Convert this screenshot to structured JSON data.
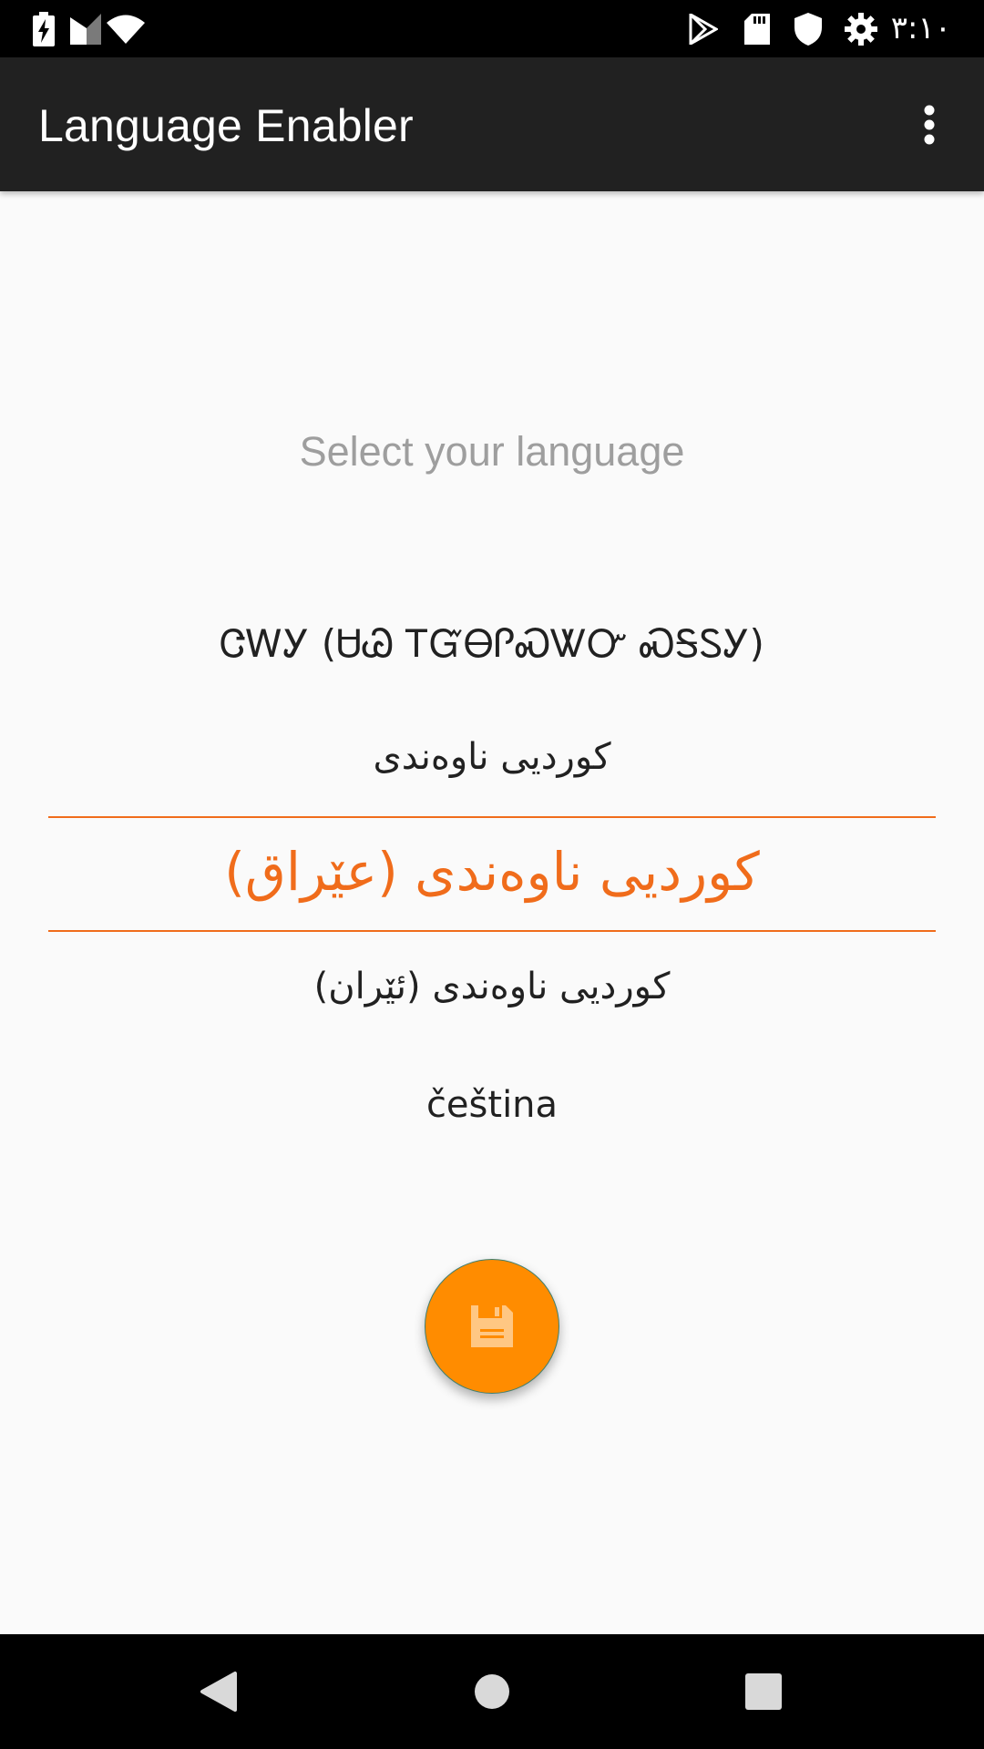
{
  "status_bar": {
    "time": "٣:١٠",
    "icons": [
      "battery-charging-icon",
      "cell-signal-icon",
      "wifi-icon",
      "play-store-icon",
      "sd-card-icon",
      "shield-icon",
      "settings-gear-icon"
    ]
  },
  "app_bar": {
    "title": "Language Enabler",
    "overflow_icon": "more-vert-icon"
  },
  "main": {
    "prompt": "Select your language",
    "languages": [
      "ᏣᎳᎩ (ᏌᏊ ᎢᏳᎾᎵᏍᏔᏅ ᏍᎦᏚᎩ)",
      "کوردیی ناوەندی",
      "کوردیی ناوەندی (عێراق)",
      "کوردیی ناوەندی (ئێران)",
      "čeština"
    ],
    "selected_index": 2,
    "save_icon": "floppy-save-icon"
  },
  "colors": {
    "accent": "#f06c1b",
    "fab": "#ff8c00",
    "app_bar": "#212121"
  },
  "nav_bar": {
    "icons": [
      "back-icon",
      "home-icon",
      "recents-icon"
    ]
  }
}
